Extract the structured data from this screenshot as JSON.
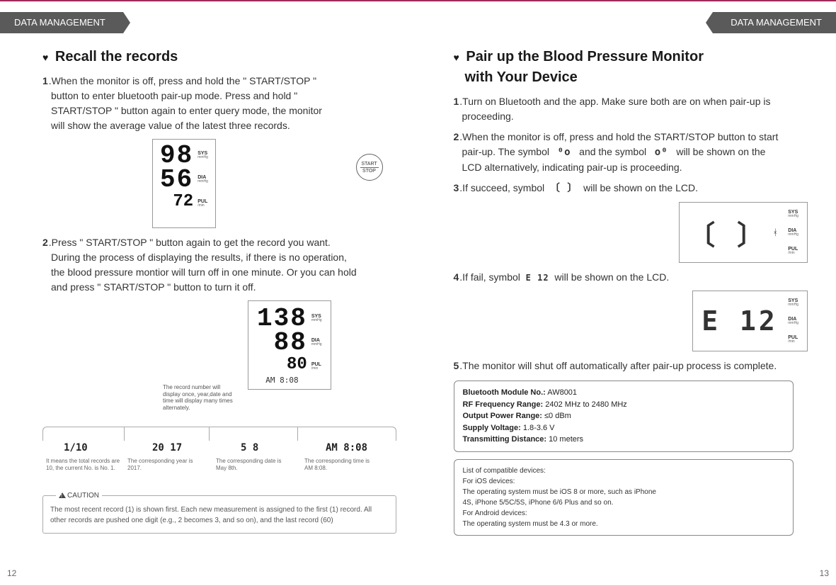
{
  "header": {
    "left": "DATA MANAGEMENT",
    "right": "DATA MANAGEMENT"
  },
  "left": {
    "title": "Recall the records",
    "p1_num": "1",
    "p1_a": ".When the monitor is off, press and hold the \" START/STOP \"",
    "p1_b": "button to enter  bluetooth pair-up mode. Press and hold \"",
    "p1_c": "START/STOP \" button again to enter query mode, the monitor",
    "p1_d": "will show the  average value of the latest three records.",
    "btn_top": "START",
    "btn_bot": "STOP",
    "lcd1": {
      "sys": "98",
      "dia": "56",
      "pul": "72"
    },
    "labels": {
      "sys": "SYS",
      "sys_u": "mmHg",
      "dia": "DIA",
      "dia_u": "mmHg",
      "pul": "PUL",
      "pul_u": "/min"
    },
    "p2_num": "2",
    "p2_a": ".Press \" START/STOP \" button again to get the record you want.",
    "p2_b": "During the process of displaying the results,  if there is no operation,",
    "p2_c": "the blood pressure montior will turn off in one minute. Or you can hold",
    "p2_d": "and press \" START/STOP \" button to turn it off.",
    "lcd2": {
      "sys": "138",
      "dia": "88",
      "pul": "80",
      "time": "AM  8:08"
    },
    "note": "The record number will display once, year,date and time will display many times alternately.",
    "mini": {
      "d1": "1/10",
      "d2": "20 17",
      "d3": "5  8",
      "d4": "AM  8:08"
    },
    "captions": {
      "c1": "It means the total records are 10, the current No. is No. 1.",
      "c2": "The corresponding year is 2017.",
      "c3": "The corresponding date is May 8th.",
      "c4": "The corresponding time is AM 8:08."
    },
    "caution_label": "CAUTION",
    "caution": "The most recent record (1) is shown first.  Each new measurement is assigned to the first (1) record. All other records are pushed one digit (e.g., 2 becomes 3, and so on), and the last record (60)",
    "pagenum": "12"
  },
  "right": {
    "title_a": "Pair up the Blood Pressure Monitor",
    "title_b": "with Your Device",
    "p1_num": "1",
    "p1_a": ".Turn on Bluetooth and the app. Make sure both are on when pair-up is",
    "p1_b": "proceeding.",
    "p2_num": "2",
    "p2_a": ".When the monitor is off, press and hold the START/STOP button to start",
    "p2_b": "pair-up. The symbol",
    "p2_c": "and the symbol",
    "p2_d": "will be shown on the",
    "p2_e": "LCD alternatively, indicating pair-up is proceeding.",
    "sym_a": "⁰o",
    "sym_b": "o⁰",
    "p3_num": "3",
    "p3": ".If succeed, symbol",
    "p3_end": "will be shown on the LCD.",
    "sym_suc": "〔 〕",
    "lcd3_sym": "〔 〕",
    "p4_num": "4",
    "p4": ".If fail, symbol",
    "p4_end": "will be shown on the LCD.",
    "sym_fail": "E 12",
    "lcd4_sym": "E 12",
    "p5_num": "5",
    "p5": ".The monitor will shut off automatically after pair-up process is complete.",
    "spec": {
      "k1": "Bluetooth Module No.:",
      "v1": "AW8001",
      "k2": "RF Frequency Range:",
      "v2": "2402 MHz to 2480 MHz",
      "k3": "Output Power Range:",
      "v3": "≤0 dBm",
      "k4": "Supply Voltage:",
      "v4": "1.8-3.6 V",
      "k5": "Transmitting Distance:",
      "v5": "10 meters"
    },
    "compat": {
      "l1": "List of compatible devices:",
      "l2": "For iOS devices:",
      "l3": "The operating system must be iOS 8 or more, such as iPhone",
      "l4": "4S, iPhone 5/5C/5S, iPhone 6/6 Plus and so on.",
      "l5": "For Android devices:",
      "l6": "The operating system must be 4.3 or more."
    },
    "pagenum": "13"
  }
}
